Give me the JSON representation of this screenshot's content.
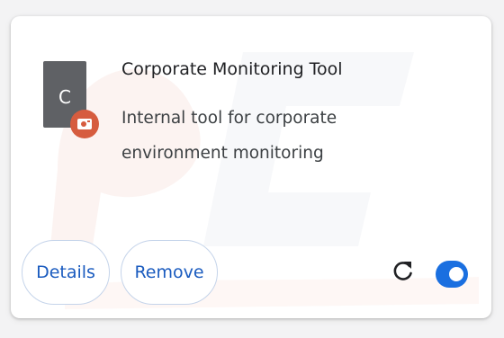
{
  "extension": {
    "icon_letter": "C",
    "name": "Corporate Monitoring Tool",
    "description": "Internal tool for corporate environment monitoring",
    "enabled": true
  },
  "actions": {
    "details_label": "Details",
    "remove_label": "Remove"
  },
  "icons": {
    "badge": "managed-policy-icon",
    "reload": "reload-icon"
  },
  "colors": {
    "accent": "#1a6fe0",
    "button_text": "#1a5bbf",
    "icon_bg": "#5f6165",
    "badge": "#d65c3f"
  }
}
